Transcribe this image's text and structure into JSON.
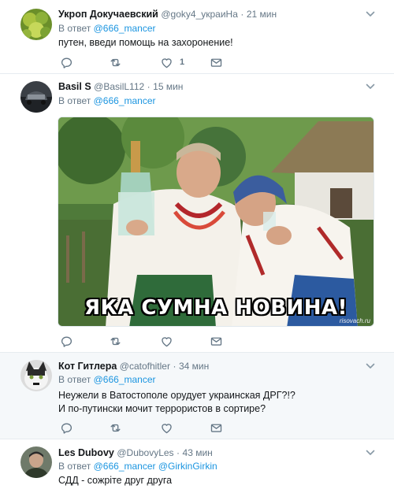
{
  "tweets": [
    {
      "name": "Укроп Докучаевский",
      "handle": "@goky4_украиНа",
      "dot": "·",
      "time": "21 мин",
      "reply_prefix": "В ответ",
      "reply_mention": "@666_mancer",
      "text": [
        "путен, введи помощь на захоронение!"
      ],
      "likes": "1"
    },
    {
      "name": "Basil S",
      "handle": "@BasilL112",
      "dot": "·",
      "time": "15 мин",
      "reply_prefix": "В ответ",
      "reply_mention": "@666_mancer",
      "meme_caption": "ЯКА СУМНА НОВИНА!",
      "meme_watermark": "risovach.ru"
    },
    {
      "name": "Кот Гитлера",
      "handle": "@catofhitler",
      "dot": "·",
      "time": "34 мин",
      "reply_prefix": "В ответ",
      "reply_mention": "@666_mancer",
      "text": [
        "Неужели в Ватостополе орудует украинская ДРГ?!?",
        "И по-путински мочит террористов в сортире?"
      ]
    },
    {
      "name": "Les Dubovy",
      "handle": "@DubovyLes",
      "dot": "·",
      "time": "43 мин",
      "reply_prefix": "В ответ",
      "reply_mention": "@666_mancer @GirkinGirkin",
      "text": [
        "СДД - сожріте друг друга"
      ]
    }
  ],
  "colors": {
    "link": "#1b95e0",
    "secondary": "#657786",
    "border": "#e6ecf0",
    "shaded_bg": "#f5f8fa"
  },
  "icons": [
    "reply-icon",
    "retweet-icon",
    "like-icon",
    "message-icon",
    "caret-down-icon"
  ]
}
